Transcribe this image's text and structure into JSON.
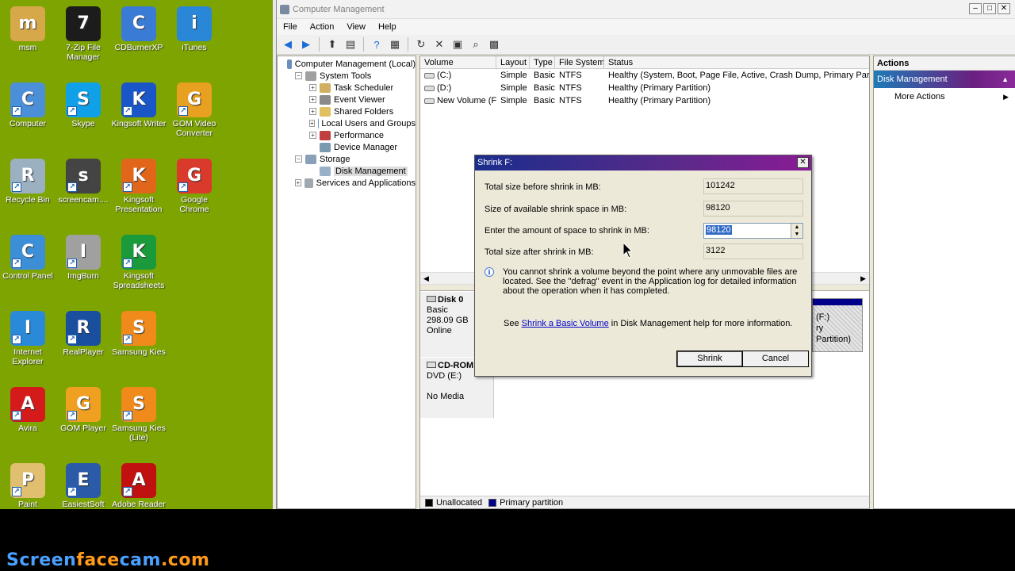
{
  "desktop": {
    "icons": [
      {
        "label": "msm",
        "icon": "user-folder-icon",
        "color": "#d6a84a"
      },
      {
        "label": "7-Zip File Manager",
        "icon": "7zip-icon",
        "color": "#1c1c1c"
      },
      {
        "label": "CDBurnerXP",
        "icon": "cd-burner-icon",
        "color": "#3a7bd5"
      },
      {
        "label": "iTunes",
        "icon": "itunes-icon",
        "color": "#2a86d6"
      },
      {
        "label": "Computer",
        "icon": "computer-icon",
        "color": "#4a8fd8"
      },
      {
        "label": "Skype",
        "icon": "skype-icon",
        "color": "#10a0e8"
      },
      {
        "label": "Kingsoft Writer",
        "icon": "kingsoft-writer-icon",
        "color": "#1b56c8"
      },
      {
        "label": "GOM Video Converter",
        "icon": "gom-converter-icon",
        "color": "#e8a020"
      },
      {
        "label": "Recycle Bin",
        "icon": "recycle-bin-icon",
        "color": "#9bb0c0"
      },
      {
        "label": "screencam....",
        "icon": "webcam-icon",
        "color": "#444444"
      },
      {
        "label": "Kingsoft Presentation",
        "icon": "kingsoft-presentation-icon",
        "color": "#e2661a"
      },
      {
        "label": "Google Chrome",
        "icon": "chrome-icon",
        "color": "#d93a2b"
      },
      {
        "label": "Control Panel",
        "icon": "control-panel-icon",
        "color": "#3c8fd6"
      },
      {
        "label": "ImgBurn",
        "icon": "imgburn-icon",
        "color": "#a0a0a0"
      },
      {
        "label": "Kingsoft Spreadsheets",
        "icon": "kingsoft-spreadsheets-icon",
        "color": "#1a9a3a"
      },
      {
        "label": "",
        "icon": "",
        "color": ""
      },
      {
        "label": "Internet Explorer",
        "icon": "internet-explorer-icon",
        "color": "#2a8ad8"
      },
      {
        "label": "RealPlayer",
        "icon": "realplayer-icon",
        "color": "#1a4fa0"
      },
      {
        "label": "Samsung Kies",
        "icon": "samsung-kies-icon",
        "color": "#f08a1a"
      },
      {
        "label": "",
        "icon": "",
        "color": ""
      },
      {
        "label": "Avira",
        "icon": "avira-icon",
        "color": "#d41a1a"
      },
      {
        "label": "GOM Player",
        "icon": "gom-player-icon",
        "color": "#f0a020"
      },
      {
        "label": "Samsung Kies (Lite)",
        "icon": "samsung-kies-lite-icon",
        "color": "#f08a1a"
      },
      {
        "label": "",
        "icon": "",
        "color": ""
      },
      {
        "label": "Paint",
        "icon": "paint-icon",
        "color": "#e0c070"
      },
      {
        "label": "EasiestSoft",
        "icon": "easiestsoft-icon",
        "color": "#2a5aa8"
      },
      {
        "label": "Adobe Reader",
        "icon": "adobe-reader-icon",
        "color": "#c01010"
      }
    ]
  },
  "window": {
    "title": "Computer Management",
    "menu": [
      "File",
      "Action",
      "View",
      "Help"
    ]
  },
  "tree": [
    {
      "label": "Computer Management (Local)",
      "level": 0,
      "exp": "",
      "icon": "computer-management-icon",
      "color": "#6a8fb8"
    },
    {
      "label": "System Tools",
      "level": 1,
      "exp": "−",
      "icon": "system-tools-icon",
      "color": "#a0a0a0"
    },
    {
      "label": "Task Scheduler",
      "level": 2,
      "exp": "+",
      "icon": "task-scheduler-icon",
      "color": "#d0b060"
    },
    {
      "label": "Event Viewer",
      "level": 2,
      "exp": "+",
      "icon": "event-viewer-icon",
      "color": "#8a8a8a"
    },
    {
      "label": "Shared Folders",
      "level": 2,
      "exp": "+",
      "icon": "shared-folders-icon",
      "color": "#e0c060"
    },
    {
      "label": "Local Users and Groups",
      "level": 2,
      "exp": "+",
      "icon": "users-icon",
      "color": "#6a9ad0"
    },
    {
      "label": "Performance",
      "level": 2,
      "exp": "+",
      "icon": "performance-icon",
      "color": "#c04040"
    },
    {
      "label": "Device Manager",
      "level": 2,
      "exp": "",
      "icon": "device-manager-icon",
      "color": "#7a9ab0"
    },
    {
      "label": "Storage",
      "level": 1,
      "exp": "−",
      "icon": "storage-icon",
      "color": "#8aa0b8"
    },
    {
      "label": "Disk Management",
      "level": 2,
      "exp": "",
      "icon": "disk-management-icon",
      "color": "#9ab0c8",
      "selected": true
    },
    {
      "label": "Services and Applications",
      "level": 1,
      "exp": "+",
      "icon": "services-icon",
      "color": "#a0a8b0"
    }
  ],
  "volumes": {
    "headers": [
      "Volume",
      "Layout",
      "Type",
      "File System",
      "Status"
    ],
    "rows": [
      [
        "(C:)",
        "Simple",
        "Basic",
        "NTFS",
        "Healthy (System, Boot, Page File, Active, Crash Dump, Primary Partition"
      ],
      [
        "(D:)",
        "Simple",
        "Basic",
        "NTFS",
        "Healthy (Primary Partition)"
      ],
      [
        "New Volume (F:)",
        "Simple",
        "Basic",
        "NTFS",
        "Healthy (Primary Partition)"
      ]
    ]
  },
  "disks": {
    "disk0": {
      "name": "Disk 0",
      "type": "Basic",
      "size": "298.09 GB",
      "status": "Online"
    },
    "cdrom": {
      "name": "CD-ROM",
      "drive": "DVD (E:)",
      "status": "No Media"
    },
    "partition": {
      "line1": "(F:)",
      "line2": "ry Partition)"
    }
  },
  "legend": {
    "unallocated": "Unallocated",
    "primary": "Primary partition",
    "unallocated_color": "#000000",
    "primary_color": "#00008b"
  },
  "actions": {
    "header": "Actions",
    "selected": "Disk Management",
    "more": "More Actions"
  },
  "dialog": {
    "title": "Shrink F:",
    "fields": [
      {
        "label": "Total size before shrink in MB:",
        "value": "101242"
      },
      {
        "label": "Size of available shrink space in MB:",
        "value": "98120"
      },
      {
        "label": "Enter the amount of space to shrink in MB:",
        "value": "98120"
      },
      {
        "label": "Total size after shrink in MB:",
        "value": "3122"
      }
    ],
    "info": "You cannot shrink a volume beyond the point where any unmovable files are located. See the \"defrag\" event in the Application log for detailed information about the operation when it has completed.",
    "see_prefix": "See",
    "see_link": "Shrink a Basic Volume",
    "see_suffix": "in Disk Management help for more information.",
    "shrink": "Shrink",
    "cancel": "Cancel"
  },
  "watermark": {
    "part1": "Screen",
    "part2": "face",
    "part3": "cam",
    "part4": ".com",
    "color1": "#4aa0ff",
    "color2": "#ff9a1a"
  }
}
